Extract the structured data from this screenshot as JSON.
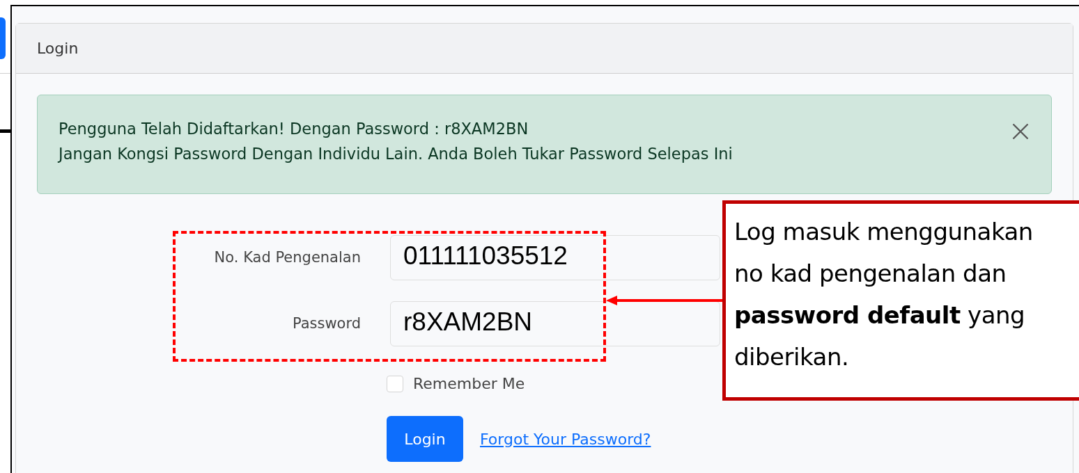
{
  "card": {
    "title": "Login"
  },
  "alert": {
    "lines": [
      "Pengguna Telah Didaftarkan! Dengan Password : r8XAM2BN",
      "Jangan Kongsi Password Dengan Individu Lain. Anda Boleh Tukar Password Selepas Ini"
    ]
  },
  "form": {
    "fields": [
      {
        "label": "No. Kad Pengenalan",
        "value": "011111035512"
      },
      {
        "label": "Password",
        "value": "r8XAM2BN"
      }
    ],
    "remember": {
      "label": "Remember Me",
      "checked": false
    },
    "submit": "Login",
    "forgot_link": "Forgot Your Password?"
  },
  "callout": {
    "lines": [
      "Log masuk menggunakan",
      "no kad pengenalan dan",
      "**password default** yang",
      "diberikan."
    ]
  }
}
